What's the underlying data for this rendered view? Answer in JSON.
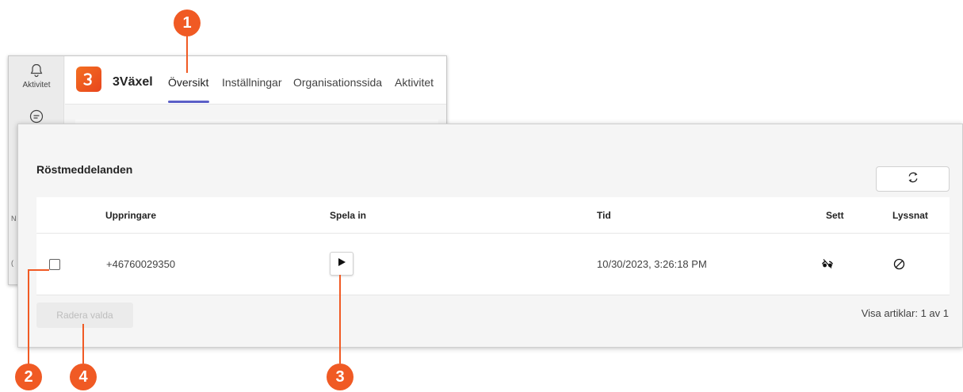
{
  "teams": {
    "rail": [
      {
        "label": "Aktivitet",
        "icon": "bell-icon"
      },
      {
        "label": "",
        "icon": "chat-icon"
      }
    ],
    "rail_fragments": [
      "N",
      "("
    ],
    "app_name": "3Växel",
    "tabs": [
      "Översikt",
      "Inställningar",
      "Organisationssida",
      "Aktivitet"
    ],
    "active_tab": "Översikt"
  },
  "voicemail": {
    "title": "Röstmeddelanden",
    "columns": {
      "caller": "Uppringare",
      "record": "Spela in",
      "time": "Tid",
      "seen": "Sett",
      "listened": "Lyssnat"
    },
    "rows": [
      {
        "caller": "+46760029350",
        "time": "10/30/2023, 3:26:18 PM",
        "seen_icon": "eye-off-icon",
        "listened_icon": "not-allowed-icon",
        "checked": false
      }
    ],
    "delete_label": "Radera valda",
    "pager_text": "Visa artiklar: 1 av 1"
  },
  "callouts": [
    "1",
    "2",
    "3",
    "4"
  ],
  "colors": {
    "accent": "#5b5fc7",
    "callout": "#f05a24",
    "brand": "#e8451d"
  }
}
